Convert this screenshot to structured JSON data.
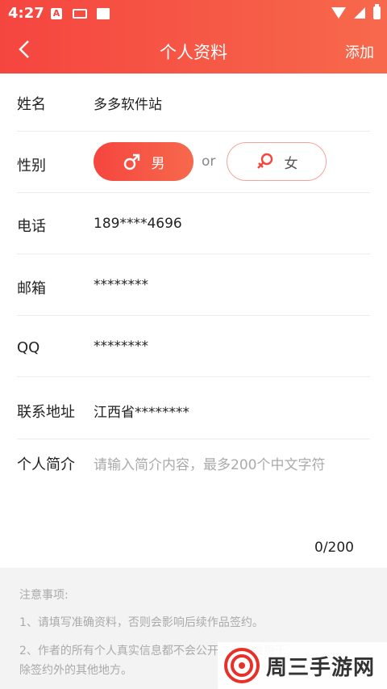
{
  "status_bar": {
    "time": "4:27",
    "a_icon_letter": "A"
  },
  "header": {
    "title": "个人资料",
    "add_label": "添加"
  },
  "form": {
    "name": {
      "label": "姓名",
      "value": "多多软件站"
    },
    "gender": {
      "label": "性别",
      "male_label": "男",
      "female_label": "女",
      "or_label": "or",
      "selected": "男"
    },
    "phone": {
      "label": "电话",
      "value": "189****4696"
    },
    "email": {
      "label": "邮箱",
      "value": "********"
    },
    "qq": {
      "label": "QQ",
      "value": "********"
    },
    "address": {
      "label": "联系地址",
      "value": "江西省********"
    },
    "intro": {
      "label": "个人简介",
      "placeholder": "请输入简介内容，最多200个中文字符",
      "counter": "0/200"
    }
  },
  "notes": {
    "title": "注意事项:",
    "item1": "1、请填写准确资料，否则会影响后续作品签约。",
    "item2": "2、作者的所有个人真实信息都不会公开，也不会用于除签约外的其他地方。"
  },
  "watermark": {
    "text": "周三手游网"
  },
  "colors": {
    "accent": "#f5453f",
    "accent_end": "#f7694c",
    "female_border": "#f3a39c"
  }
}
